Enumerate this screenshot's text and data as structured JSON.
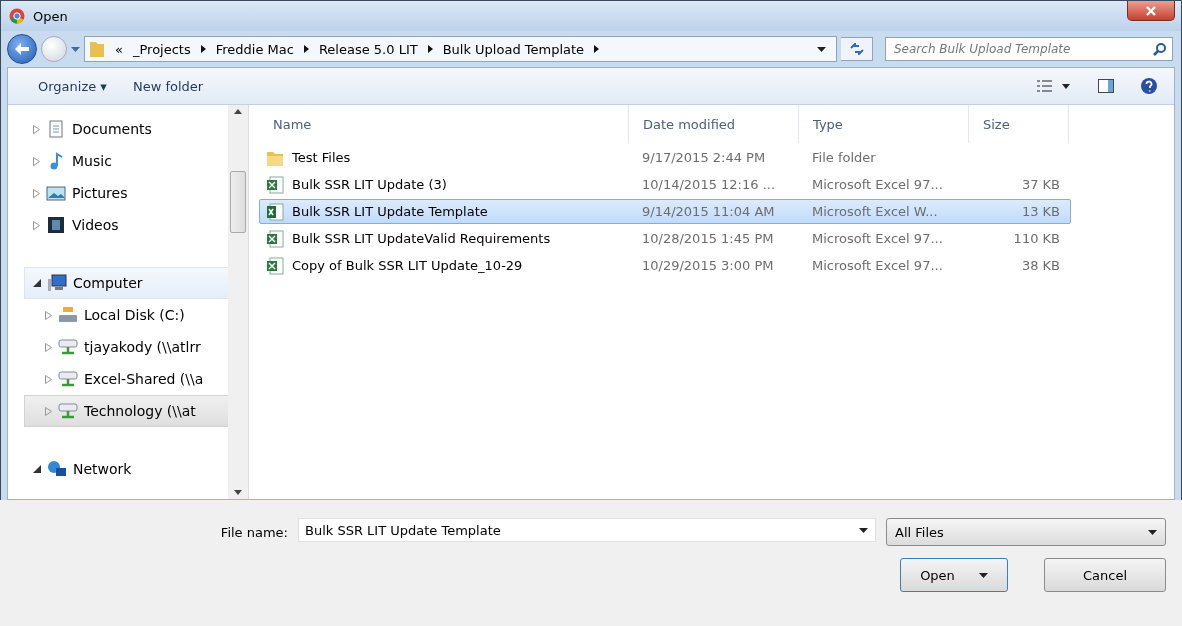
{
  "window": {
    "title": "Open"
  },
  "address": {
    "segments": [
      "«",
      "_Projects",
      "Freddie Mac",
      "Release 5.0 LIT",
      "Bulk Upload Template"
    ]
  },
  "search": {
    "placeholder": "Search Bulk Upload Template"
  },
  "toolbar": {
    "items": [
      "Organize ▾",
      "New folder"
    ]
  },
  "sidebar": {
    "items": [
      {
        "label": "Documents",
        "kind": "documents",
        "expanded": false,
        "selected": false,
        "hover": false
      },
      {
        "label": "Music",
        "kind": "music",
        "expanded": false,
        "selected": false,
        "hover": false
      },
      {
        "label": "Pictures",
        "kind": "pictures",
        "expanded": false,
        "selected": false,
        "hover": false
      },
      {
        "label": "Videos",
        "kind": "videos",
        "expanded": false,
        "selected": false,
        "hover": false
      },
      {
        "label": "Computer",
        "kind": "computer",
        "expanded": true,
        "selected": false,
        "hover": true,
        "children": [
          {
            "label": "Local Disk (C:)",
            "kind": "disk",
            "expanded": false,
            "selected": false,
            "hover": false
          },
          {
            "label": "tjayakody (\\\\atlrr",
            "kind": "netdrive",
            "expanded": false,
            "selected": false,
            "hover": false
          },
          {
            "label": "Excel-Shared (\\\\a",
            "kind": "netdrive",
            "expanded": false,
            "selected": false,
            "hover": false
          },
          {
            "label": "Technology (\\\\at",
            "kind": "netdrive",
            "expanded": false,
            "selected": true,
            "hover": false
          }
        ]
      },
      {
        "label": "Network",
        "kind": "network",
        "expanded": true,
        "selected": false,
        "hover": false
      }
    ]
  },
  "table": {
    "columns": [
      "Name",
      "Date modified",
      "Type",
      "Size"
    ],
    "rows": [
      {
        "kind": "folder",
        "name": "Test Files",
        "date": "9/17/2015 2:44 PM",
        "type": "File folder",
        "selected": false
      },
      {
        "kind": "xls",
        "name": "Bulk SSR LIT Update (3)",
        "date": "10/14/2015 12:16 ...",
        "type": "Microsoft Excel 97...",
        "size": "37 KB",
        "selected": false
      },
      {
        "kind": "xlsx",
        "name": "Bulk SSR LIT Update Template",
        "date": "9/14/2015 11:04 AM",
        "type": "Microsoft Excel W...",
        "size": "13 KB",
        "selected": true
      },
      {
        "kind": "xls",
        "name": "Bulk SSR LIT UpdateValid Requirements",
        "date": "10/28/2015 1:45 PM",
        "type": "Microsoft Excel 97...",
        "size": "110 KB",
        "selected": false
      },
      {
        "kind": "xls",
        "name": "Copy of Bulk SSR LIT Update_10-29",
        "date": "10/29/2015 3:00 PM",
        "type": "Microsoft Excel 97...",
        "size": "38 KB",
        "selected": false
      }
    ]
  },
  "file_name": {
    "label": "File name:",
    "value": "Bulk SSR LIT Update Template"
  },
  "filter": {
    "value": "All Files"
  },
  "buttons": [
    "Open",
    "Cancel"
  ]
}
